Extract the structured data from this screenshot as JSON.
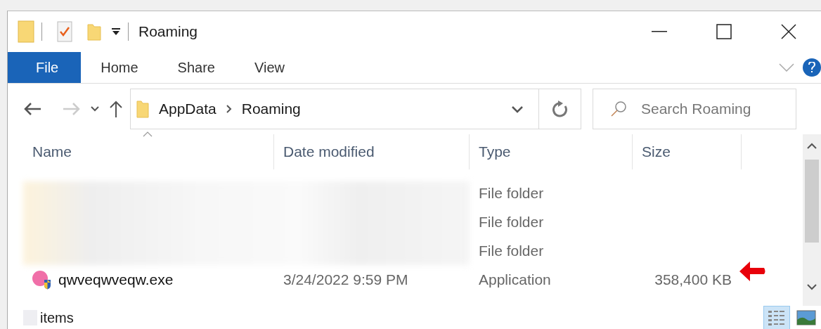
{
  "window": {
    "title": "Roaming"
  },
  "ribbon_tabs": [
    {
      "label": "File",
      "kind": "file"
    },
    {
      "label": "Home",
      "kind": "tab"
    },
    {
      "label": "Share",
      "kind": "tab"
    },
    {
      "label": "View",
      "kind": "tab"
    }
  ],
  "address_bar": {
    "path": [
      "AppData",
      "Roaming"
    ]
  },
  "search": {
    "placeholder": "Search Roaming"
  },
  "table": {
    "columns": [
      "Name",
      "Date modified",
      "Type",
      "Size"
    ],
    "rows": [
      {
        "kind": "redacted",
        "type": "File folder"
      },
      {
        "kind": "redacted",
        "type": "File folder"
      },
      {
        "kind": "redacted",
        "type": "File folder"
      },
      {
        "kind": "application",
        "name": "qwveqwveqw.exe",
        "date": "3/24/2022 9:59 PM",
        "type": "Application",
        "size": "358,400 KB"
      }
    ]
  },
  "status_bar": {
    "text": "items"
  },
  "view_buttons": [
    {
      "kind": "details",
      "selected": true
    },
    {
      "kind": "large-icons",
      "selected": false
    }
  ]
}
